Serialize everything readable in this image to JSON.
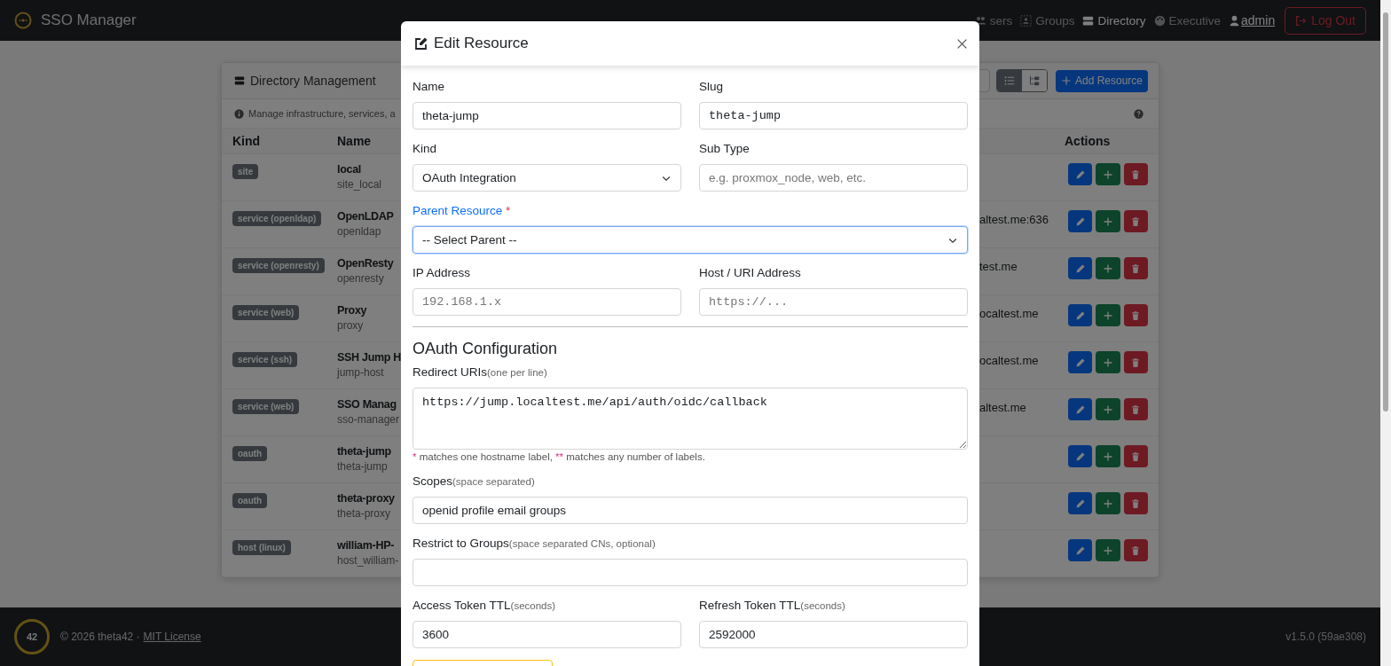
{
  "navbar": {
    "brand": "SSO Manager",
    "items": [
      {
        "label": "sers",
        "selected": false
      },
      {
        "label": "Groups",
        "selected": false
      },
      {
        "label": "Directory",
        "selected": true
      },
      {
        "label": "Executive",
        "selected": false
      }
    ],
    "user": "admin",
    "logout": "Log Out"
  },
  "card": {
    "title": "Directory Management",
    "view_toggle": [
      {
        "selected": true
      },
      {
        "selected": false
      }
    ],
    "add_button": "Add Resource",
    "info": "Manage infrastructure, services, a",
    "columns": [
      "Kind",
      "Name",
      "Actions"
    ],
    "rows": [
      {
        "kind": "site",
        "name": "local",
        "slug": "site_local"
      },
      {
        "kind": "service (openldap)",
        "name": "OpenLDAP",
        "slug": "openldap",
        "address": "altest.me:636"
      },
      {
        "kind": "service (openresty)",
        "name": "OpenResty",
        "slug": "openresty",
        "address": "test.me"
      },
      {
        "kind": "service (web)",
        "name": "Proxy",
        "slug": "proxy",
        "address": "ocaltest.me"
      },
      {
        "kind": "service (ssh)",
        "name": "SSH Jump H",
        "slug": "jump-host",
        "address": "ocaltest.me"
      },
      {
        "kind": "service (web)",
        "name": "SSO Manag",
        "slug": "sso-manager",
        "address": "altest.me"
      },
      {
        "kind": "oauth",
        "name": "theta-jump",
        "slug": "theta-jump"
      },
      {
        "kind": "oauth",
        "name": "theta-proxy",
        "slug": "theta-proxy"
      },
      {
        "kind": "host (linux)",
        "name": "william-HP-",
        "slug": "host_william-"
      }
    ]
  },
  "modal": {
    "title": "Edit Resource",
    "rows": [
      [
        {
          "label": "Name",
          "kind": "text",
          "value": "theta-jump"
        },
        {
          "label": "Slug",
          "kind": "mono",
          "value": "theta-jump"
        }
      ],
      [
        {
          "label": "Kind",
          "kind": "select",
          "value": "OAuth Integration"
        },
        {
          "label": "Sub Type",
          "kind": "text",
          "placeholder": "e.g. proxmox_node, web, etc."
        }
      ],
      [
        {
          "label": "Parent Resource",
          "required": true,
          "focused": true,
          "kind": "select",
          "value": "-- Select Parent --"
        }
      ],
      [
        {
          "label": "IP Address",
          "kind": "mono",
          "placeholder": "192.168.1.x"
        },
        {
          "label": "Host / URI Address",
          "kind": "mono",
          "placeholder": "https://..."
        }
      ]
    ],
    "section": "OAuth Configuration",
    "oauth_rows": [
      [
        {
          "label": "Redirect URIs",
          "hint": "(one per line)",
          "kind": "textarea",
          "value": "https://jump.localtest.me/api/auth/oidc/callback",
          "help": [
            {
              "text": "*",
              "mark": true
            },
            {
              "text": " matches one hostname label, ",
              "mark": false
            },
            {
              "text": "**",
              "mark": true
            },
            {
              "text": " matches any number of labels.",
              "mark": false
            }
          ]
        }
      ],
      [
        {
          "label": "Scopes",
          "hint": "(space separated)",
          "kind": "text",
          "value": "openid profile email groups"
        }
      ],
      [
        {
          "label": "Restrict to Groups",
          "hint": "(space separated CNs, optional)",
          "kind": "text"
        }
      ],
      [
        {
          "label": "Access Token TTL",
          "hint": "(seconds)",
          "kind": "text",
          "value": "3600"
        },
        {
          "label": "Refresh Token TTL",
          "hint": "(seconds)",
          "kind": "text",
          "value": "2592000"
        }
      ]
    ]
  },
  "footer": {
    "logo": "42",
    "copyright": "© 2026 theta42 ·",
    "license": "MIT License",
    "version": "v1.5.0 (59ae308)"
  }
}
